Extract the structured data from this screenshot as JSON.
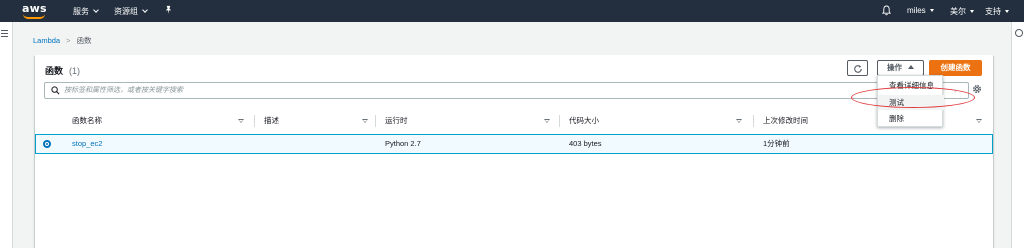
{
  "nav": {
    "logo_text": "aws",
    "services": "服务",
    "resource_groups": "资源组",
    "pin_icon": "pushpin-icon",
    "bell_icon": "bell-icon",
    "user": "miles",
    "region": "美尔",
    "support": "支持"
  },
  "breadcrumb": {
    "root": "Lambda",
    "current": "函数"
  },
  "panel": {
    "title": "函数",
    "count": "(1)",
    "refresh_icon": "refresh-icon",
    "actions_label": "操作",
    "create_label": "创建函数"
  },
  "search": {
    "placeholder": "按标签和属性筛选，或者按关键字搜索",
    "value": ""
  },
  "table": {
    "columns": [
      "函数名称",
      "描述",
      "运行时",
      "代码大小",
      "上次修改时间"
    ],
    "rows": [
      {
        "name": "stop_ec2",
        "description": "",
        "runtime": "Python 2.7",
        "code_size": "403 bytes",
        "last_modified": "1分钟前",
        "selected": true
      }
    ]
  },
  "actions_menu": {
    "items": [
      "查看详细信息",
      "测试",
      "删除"
    ],
    "highlighted": "测试"
  },
  "colors": {
    "nav_bg": "#232f3e",
    "accent_orange": "#ec7211",
    "link_blue": "#0073bb",
    "selected_row_border": "#00a1c9",
    "annotation_red": "#e0393b"
  }
}
